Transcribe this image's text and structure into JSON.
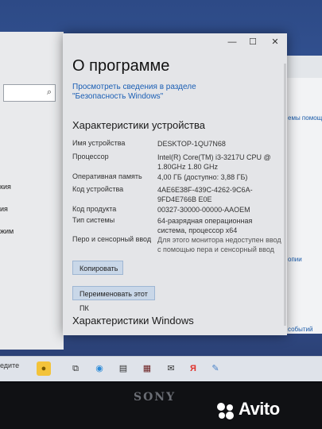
{
  "dialog": {
    "heading": "О программе",
    "security_link": "Просмотреть сведения в разделе \"Безопасность Windows\"",
    "device_section_title": "Характеристики устройства",
    "specs": [
      {
        "label": "Имя устройства",
        "value": "DESKTOP-1QU7N68"
      },
      {
        "label": "Процессор",
        "value": "Intel(R) Core(TM) i3-3217U CPU @ 1.80GHz   1.80 GHz"
      },
      {
        "label": "Оперативная память",
        "value": "4,00 ГБ (доступно: 3,88 ГБ)"
      },
      {
        "label": "Код устройства",
        "value": "4AE6E38F-439C-4262-9C6A-9FD4E766B E0E"
      },
      {
        "label": "Код продукта",
        "value": "00327-30000-00000-AAOEM"
      },
      {
        "label": "Тип системы",
        "value": "64-разрядная операционная система, процессор x64"
      },
      {
        "label": "Перо и сенсорный ввод",
        "value": "Для этого монитора недоступен ввод с помощью пера и сенсорный ввод"
      }
    ],
    "copy_button": "Копировать",
    "rename_button": "Переименовать этот ПК",
    "windows_section_title": "Характеристики Windows",
    "minimize": "—",
    "maximize": "☐",
    "close": "✕"
  },
  "left_window": {
    "items": [
      "кия",
      "ия",
      "жим"
    ]
  },
  "right_window": {
    "items": [
      "емы помощи",
      "опии",
      "событий"
    ]
  },
  "taskbar": {
    "search_text": "едите",
    "icons": [
      "task-view-icon",
      "edge-icon",
      "store-icon",
      "mail-icon",
      "yandex-icon",
      "paint-icon",
      "app-icon"
    ]
  },
  "bezel": {
    "brand": "SONY",
    "watermark": "Avito"
  }
}
